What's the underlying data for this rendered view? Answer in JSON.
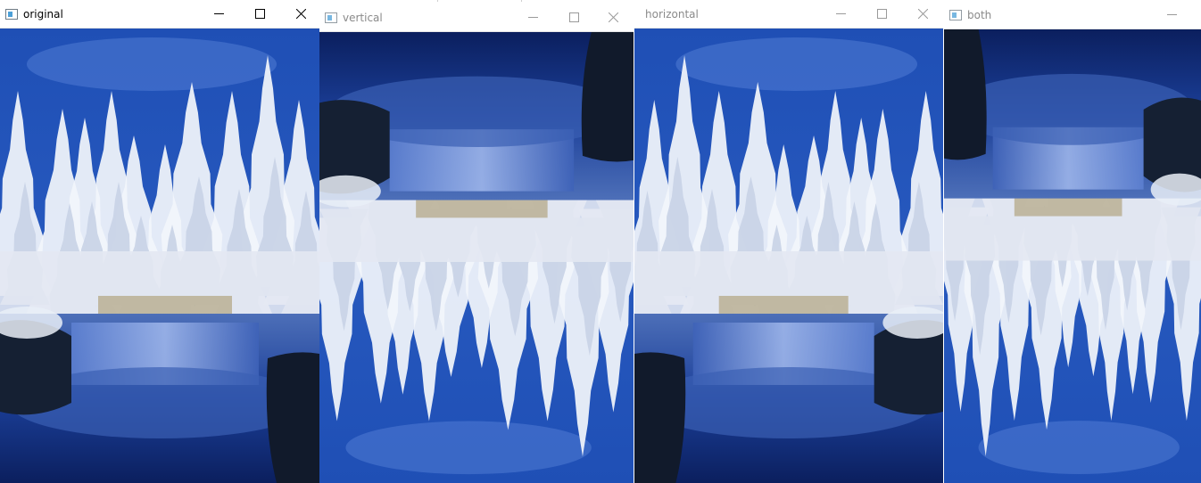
{
  "windows": [
    {
      "id": "original",
      "title": "original",
      "active": true,
      "flip": "none",
      "buttons": {
        "minimize": "minimize",
        "maximize": "maximize",
        "close": "close"
      }
    },
    {
      "id": "vertical",
      "title": "vertical",
      "active": false,
      "flip": "vertical",
      "buttons": {
        "minimize": "minimize",
        "maximize": "maximize",
        "close": "close"
      }
    },
    {
      "id": "horizontal",
      "title": "horizontal",
      "active": false,
      "flip": "horizontal",
      "buttons": {
        "minimize": "minimize",
        "maximize": "maximize",
        "close": "close"
      }
    },
    {
      "id": "both",
      "title": "both",
      "active": false,
      "flip": "both",
      "buttons": {
        "minimize": "minimize"
      }
    }
  ],
  "icons": [
    "app-window-icon",
    "minimize-icon",
    "maximize-icon",
    "close-icon"
  ],
  "image_subject": "frozen trees above a blue waterfall",
  "colors": {
    "titlebar_bg": "#ffffff",
    "active_title_text": "#000000",
    "inactive_title_text": "#8a8a8a",
    "sky_blue": "#2f63c8",
    "water_blue": "#1b3f99",
    "frost_white": "#f2f5fb"
  }
}
